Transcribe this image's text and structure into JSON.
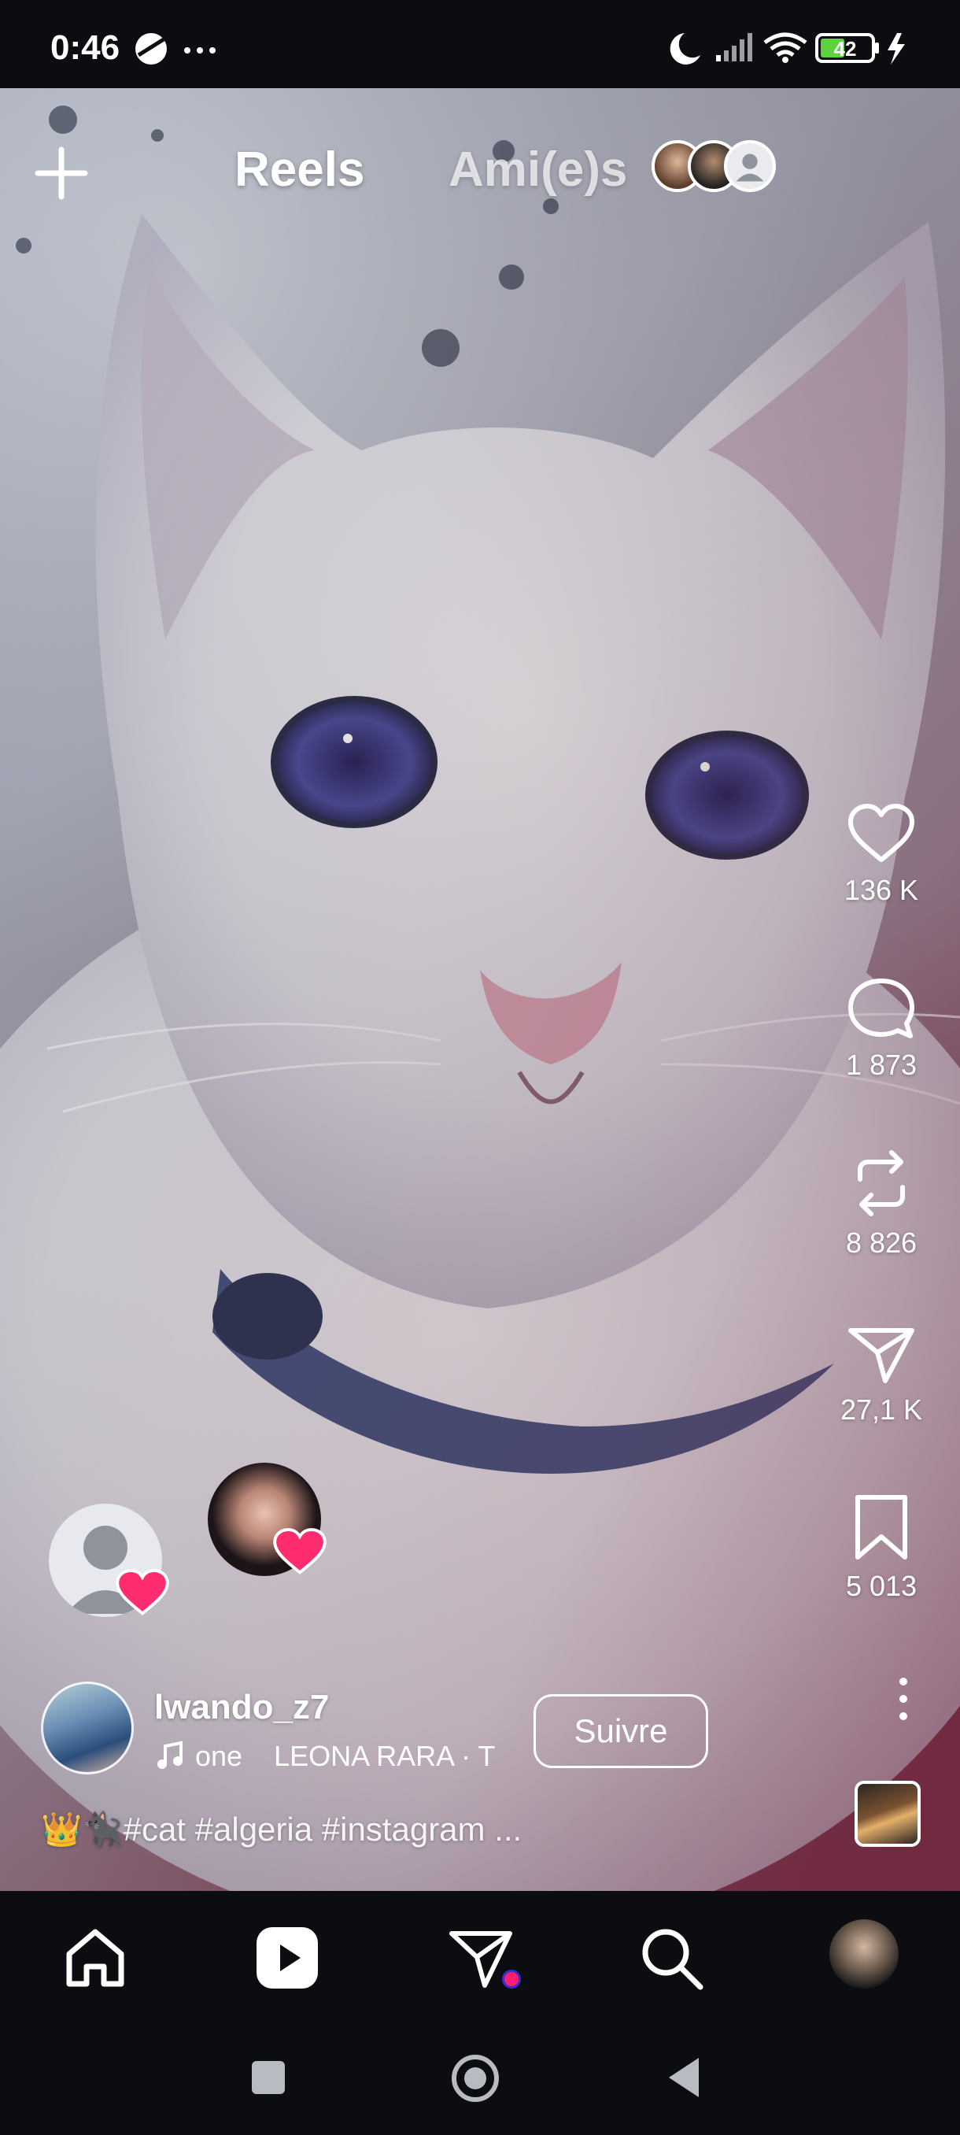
{
  "status_bar": {
    "time": "0:46",
    "battery": "42"
  },
  "top_bar": {
    "tab_reels": "Reels",
    "tab_friends": "Ami(e)s"
  },
  "actions": {
    "likes": "136 K",
    "comments": "1 873",
    "reposts": "8 826",
    "shares": "27,1 K",
    "saves": "5 013"
  },
  "reel": {
    "author": "lwando_z7",
    "music": "one    LEONA RARA · T",
    "follow_label": "Suivre",
    "caption": "👑🐈‍⬛#cat #algeria #instagram ..."
  },
  "colors": {
    "background": "#0b0d10",
    "heart": "#ff2d6f",
    "dm_badge": "#ff1f6d"
  },
  "icons": [
    "create-icon",
    "heart-icon",
    "comment-icon",
    "repost-icon",
    "share-icon",
    "bookmark-icon",
    "more-icon",
    "home-icon",
    "reels-icon",
    "messages-icon",
    "search-icon",
    "music-icon"
  ]
}
